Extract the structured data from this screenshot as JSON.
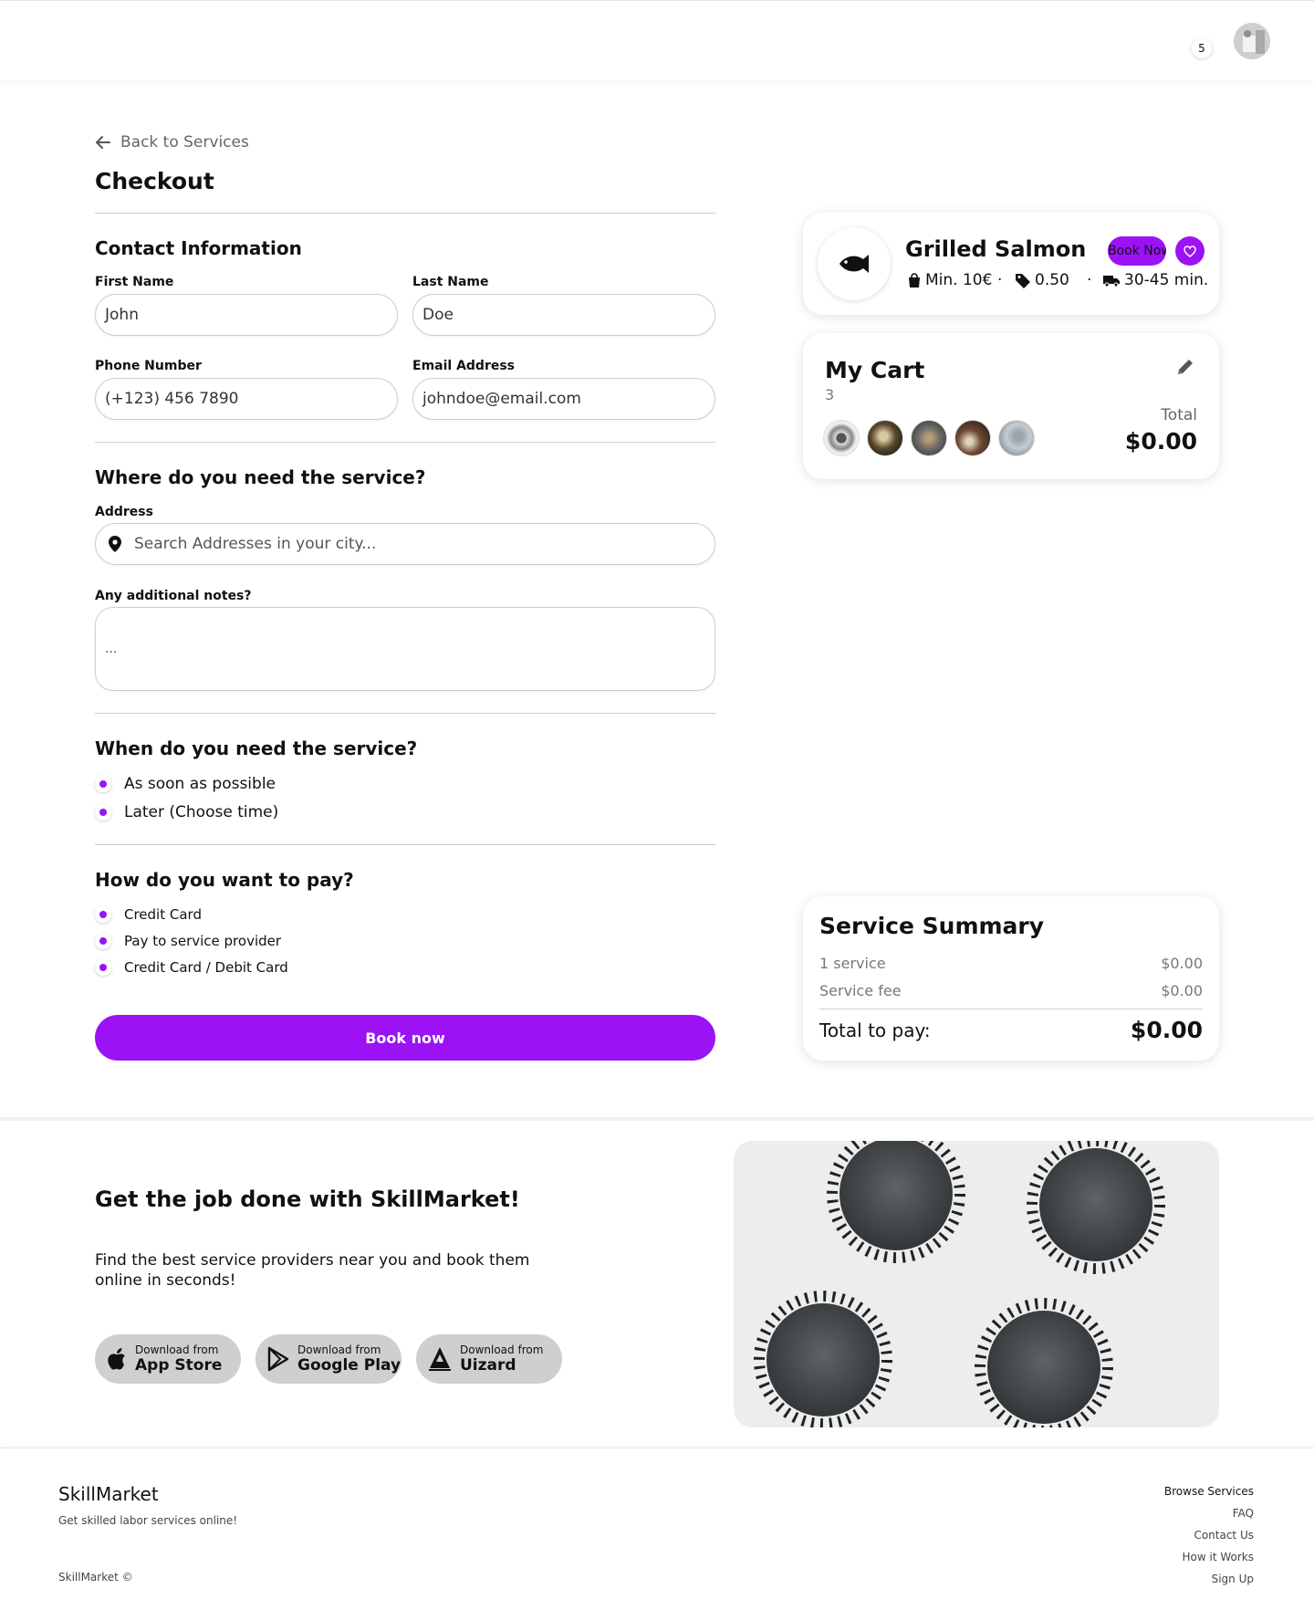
{
  "header": {
    "notification_count": "5"
  },
  "checkout": {
    "back_label": "Back to Services",
    "title": "Checkout",
    "contact": {
      "heading": "Contact Information",
      "first_name_label": "First Name",
      "first_name_value": "John",
      "last_name_label": "Last Name",
      "last_name_value": "Doe",
      "phone_label": "Phone Number",
      "phone_value": "(+123) 456 7890",
      "email_label": "Email Address",
      "email_value": "johndoe@email.com"
    },
    "location": {
      "heading": "Where do you need the service?",
      "address_label": "Address",
      "address_placeholder": "Search Addresses in your city...",
      "notes_label": "Any additional notes?",
      "notes_placeholder": "..."
    },
    "time": {
      "heading": "When do you need the service?",
      "options": [
        "As soon as possible",
        "Later (Choose time)"
      ]
    },
    "payment": {
      "heading": "How do you want to pay?",
      "options": [
        "Credit Card",
        "Pay to service provider",
        "Credit Card / Debit Card"
      ]
    },
    "book_button": "Book now"
  },
  "service_card": {
    "icon": "fish-icon",
    "title": "Grilled Salmon",
    "book_label": "Book Now",
    "min_order": "Min. 10€",
    "fee": "0.50",
    "delivery_time": "30-45 min."
  },
  "cart": {
    "title": "My Cart",
    "count": "3",
    "total_label": "Total",
    "total_value": "$0.00"
  },
  "summary": {
    "title": "Service Summary",
    "rows": [
      {
        "label": "1 service",
        "value": "$0.00"
      },
      {
        "label": "Service fee",
        "value": "$0.00"
      }
    ],
    "total_label": "Total to pay:",
    "total_value": "$0.00"
  },
  "promo": {
    "title": "Get the job done with SkillMarket!",
    "text": "Find the best service providers near you and book them online in seconds!",
    "stores": [
      {
        "small": "Download from",
        "name": "App Store",
        "icon": "apple-icon"
      },
      {
        "small": "Download from",
        "name": "Google Play",
        "icon": "google-play-icon"
      },
      {
        "small": "Download from",
        "name": "Uizard",
        "icon": "uizard-icon"
      }
    ]
  },
  "footer": {
    "brand": "SkillMarket",
    "tagline": "Get skilled labor services online!",
    "copyright": "SkillMarket ©",
    "links": [
      "Browse Services",
      "FAQ",
      "Contact Us",
      "How it Works",
      "Sign Up"
    ]
  },
  "colors": {
    "accent": "#9b12f5",
    "store_button": "#cfcfcf"
  }
}
